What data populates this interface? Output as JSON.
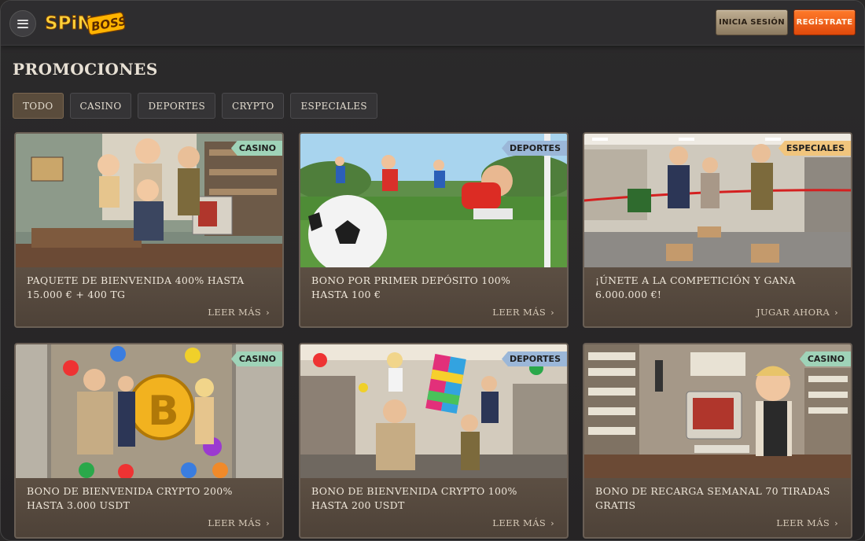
{
  "header": {
    "logo_text": "SPIN BOSS",
    "login_label": "INICIA SESIÓN",
    "register_label": "REGÍSTRATE"
  },
  "page": {
    "title": "PROMOCIONES"
  },
  "tabs": [
    {
      "label": "TODO",
      "active": true
    },
    {
      "label": "CASINO",
      "active": false
    },
    {
      "label": "DEPORTES",
      "active": false
    },
    {
      "label": "CRYPTO",
      "active": false
    },
    {
      "label": "ESPECIALES",
      "active": false
    }
  ],
  "cards": [
    {
      "badge": "CASINO",
      "title": "PAQUETE DE BIENVENIDA 400% HASTA 15.000 € + 400 TG",
      "cta": "LEER MÁS"
    },
    {
      "badge": "DEPORTES",
      "title": "BONO POR PRIMER DEPÓSITO 100% HASTA 100 €",
      "cta": "LEER MÁS"
    },
    {
      "badge": "ESPECIALES",
      "title": "¡ÚNETE A LA COMPETICIÓN Y GANA 6.000.000 €!",
      "cta": "JUGAR AHORA"
    },
    {
      "badge": "CASINO",
      "title": "BONO DE BIENVENIDA CRYPTO 200% HASTA 3.000 USDT",
      "cta": "LEER MÁS"
    },
    {
      "badge": "DEPORTES",
      "title": "BONO DE BIENVENIDA CRYPTO 100% HASTA 200 USDT",
      "cta": "LEER MÁS"
    },
    {
      "badge": "CASINO",
      "title": "BONO DE RECARGA SEMANAL 70 TIRADAS GRATIS",
      "cta": "LEER MÁS"
    }
  ],
  "icons": {
    "menu": "hamburger-menu-icon",
    "chevron": "chevron-right-icon"
  },
  "colors": {
    "register_button": "#ff6a1f",
    "login_button": "#a8967a",
    "badge_casino": "#9fd3b8",
    "badge_deportes": "#9bb7d8",
    "badge_especiales": "#f1c57d"
  }
}
